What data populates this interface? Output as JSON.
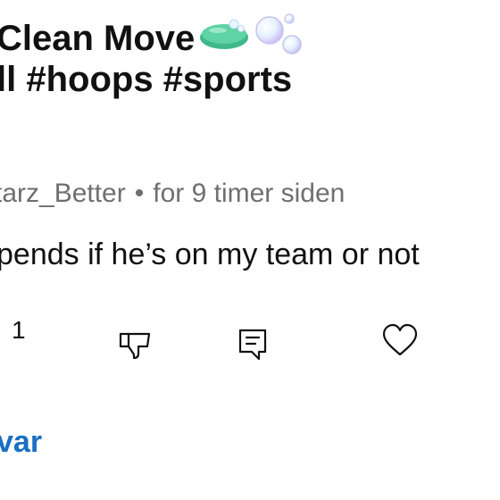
{
  "post": {
    "title_line_1": "Clean Move",
    "title_line_2": "ll #hoops #sports",
    "emoji": [
      "soap-icon",
      "bubbles-icon"
    ]
  },
  "comment": {
    "author": "tarz_Better",
    "separator": "•",
    "timestamp": "for 9 timer siden",
    "text": "pends if he’s on my team or not",
    "like_count": "1",
    "actions": [
      "dislike-icon",
      "comment-icon",
      "heart-icon"
    ],
    "reply_label": "var"
  },
  "colors": {
    "text": "#111111",
    "meta": "#6f6f6f",
    "link": "#1a6fc4"
  }
}
